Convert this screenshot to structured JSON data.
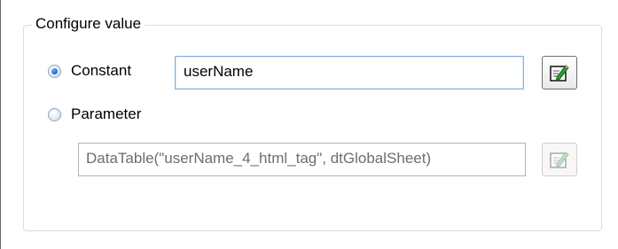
{
  "group": {
    "title": "Configure value"
  },
  "options": {
    "constant": {
      "label": "Constant",
      "selected": true,
      "value": "userName"
    },
    "parameter": {
      "label": "Parameter",
      "selected": false,
      "value": "DataTable(\"userName_4_html_tag\", dtGlobalSheet)"
    }
  },
  "icons": {
    "constant_edit": "edit-pencil-icon",
    "parameter_edit": "edit-pencil-icon"
  },
  "colors": {
    "radio_selected": "#1d64c8",
    "focus_border": "#7fb2e2",
    "pencil": "#2aa02a"
  }
}
